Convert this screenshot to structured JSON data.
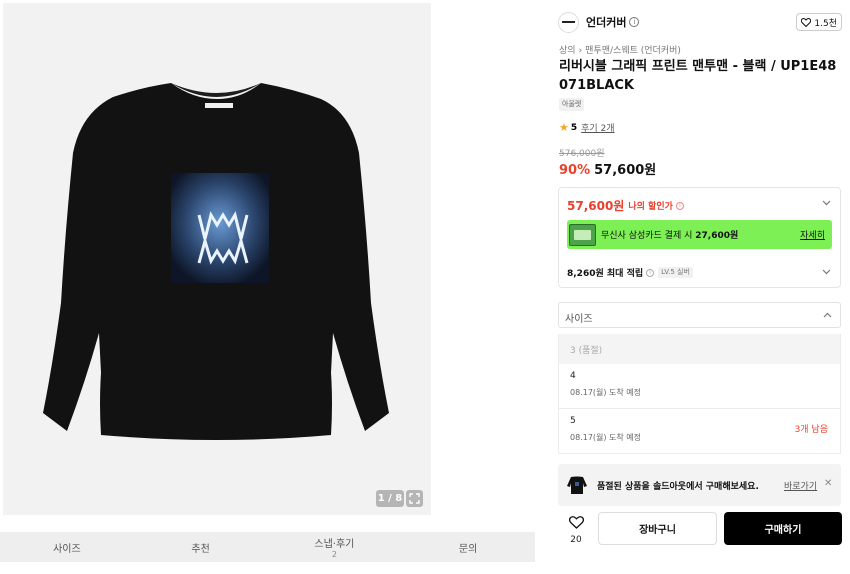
{
  "gallery": {
    "counter": "1 / 8",
    "icons": {
      "zoom": "expand-icon"
    }
  },
  "tabs": [
    {
      "label": "사이즈",
      "sub": ""
    },
    {
      "label": "추천",
      "sub": ""
    },
    {
      "label": "스냅·후기",
      "sub": "2"
    },
    {
      "label": "문의",
      "sub": ""
    }
  ],
  "brand": {
    "name": "언더커버",
    "likes": "1.5천"
  },
  "breadcrumb": [
    "상의",
    "맨투맨/스웨트 (언더커버)"
  ],
  "product": {
    "title": "리버시블 그래픽 프린트 맨투맨 - 블랙 / UP1E48071BLACK",
    "tag": "아울렛",
    "rating": "5",
    "reviews": "후기 2개",
    "original_price": "576,000원",
    "discount": "90%",
    "sale_price": "57,600원"
  },
  "benefit": {
    "my_price": "57,600원",
    "my_price_label": "나의 할인가",
    "card_banner_prefix": "무신사 삼성카드 결제 시",
    "card_banner_price": "27,600원",
    "card_banner_more": "자세히",
    "points": "8,260원 최대 적립",
    "level": "LV.5 실버"
  },
  "size_select": {
    "label": "사이즈",
    "options": [
      {
        "size": "3 (품절)",
        "date": "",
        "stock": ""
      },
      {
        "size": "4",
        "date": "08.17(월) 도착 예정",
        "stock": ""
      },
      {
        "size": "5",
        "date": "08.17(월) 도착 예정",
        "stock": "3개 남음"
      }
    ]
  },
  "notify": {
    "text": "품절된 상품을 솔드아웃에서 구매해보세요.",
    "go": "바로가기",
    "close": "✕"
  },
  "actions": {
    "like_count": "20",
    "cart": "장바구니",
    "buy": "구매하기"
  },
  "colors": {
    "accent_red": "#e8412c",
    "card_banner": "#7cf055",
    "buy_button": "#000000"
  }
}
